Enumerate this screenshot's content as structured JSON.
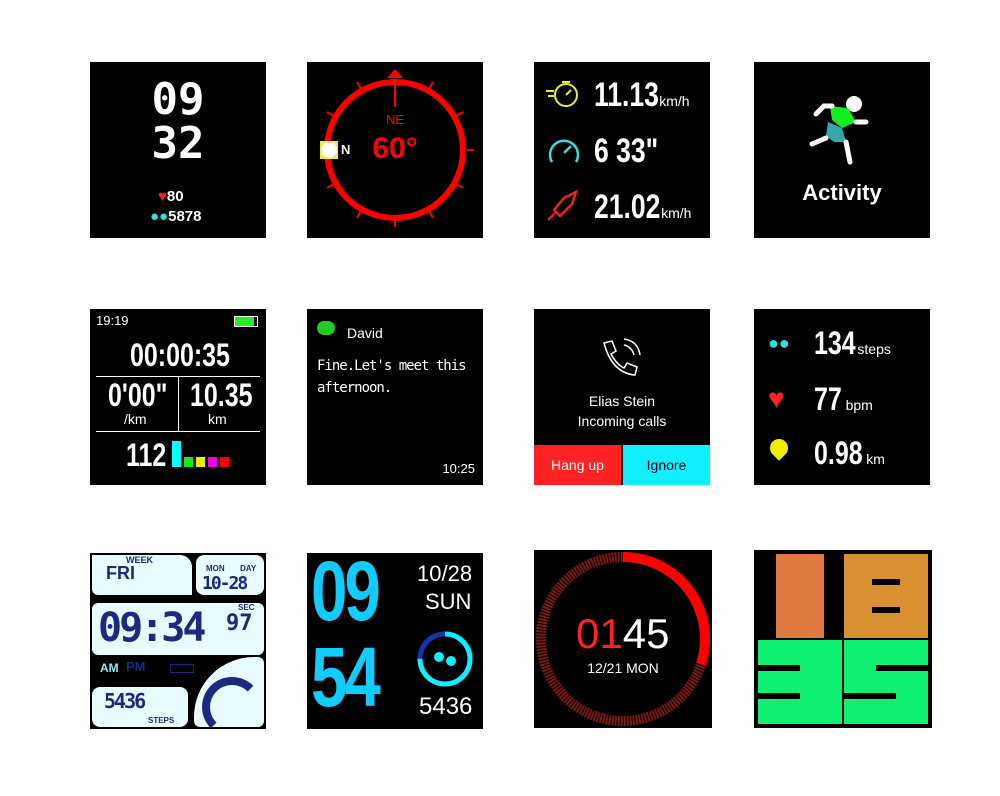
{
  "faces": {
    "digital": {
      "hour": "09",
      "minute": "32",
      "heart_rate": "80",
      "steps": "5878",
      "heart_color": "#ff2020",
      "steps_color": "#30e0e0"
    },
    "compass": {
      "direction": "NE",
      "degrees": "60°",
      "north_label": "N",
      "accent": "#ff0000"
    },
    "speed": {
      "speed": "11.13",
      "speed_unit": "km/h",
      "pace": "6 33\"",
      "max_speed": "21.02",
      "max_unit": "km/h",
      "icons": [
        "stopwatch-icon",
        "speedometer-icon",
        "rocket-icon"
      ]
    },
    "activity": {
      "label": "Activity",
      "icon": "running-person-icon"
    },
    "workout": {
      "time": "19:19",
      "duration": "00:00:35",
      "pace": "0'00\"",
      "pace_unit": "/km",
      "distance": "10.35",
      "distance_unit": "km",
      "heart_rate": "112",
      "battery_level": 0.85
    },
    "message": {
      "sender": "David",
      "text": "Fine.Let's meet this afternoon.",
      "time": "10:25",
      "icon": "wechat-icon"
    },
    "call": {
      "caller": "Elias Stein",
      "status": "Incoming calls",
      "hangup": "Hang up",
      "ignore": "Ignore"
    },
    "health": {
      "steps": "134",
      "steps_unit": "steps",
      "bpm": "77",
      "bpm_unit": "bpm",
      "distance": "0.98",
      "distance_unit": "km"
    },
    "lcd": {
      "week_label": "WEEK",
      "weekday": "FRI",
      "mon_label": "MON",
      "day_label": "DAY",
      "date": "10-28",
      "time": "09:34",
      "sec_label": "SEC",
      "seconds": "97",
      "am": "AM",
      "pm": "PM",
      "steps": "5436",
      "steps_label": "STEPS"
    },
    "bigcyan": {
      "hour": "09",
      "minute": "54",
      "date": "10/28",
      "weekday": "SUN",
      "steps": "5436",
      "progress": 0.75
    },
    "ring": {
      "hour": "01",
      "minute": "45",
      "date": "12/21 MON",
      "progress": 0.3
    },
    "blocks": {
      "digits": "1835"
    }
  }
}
